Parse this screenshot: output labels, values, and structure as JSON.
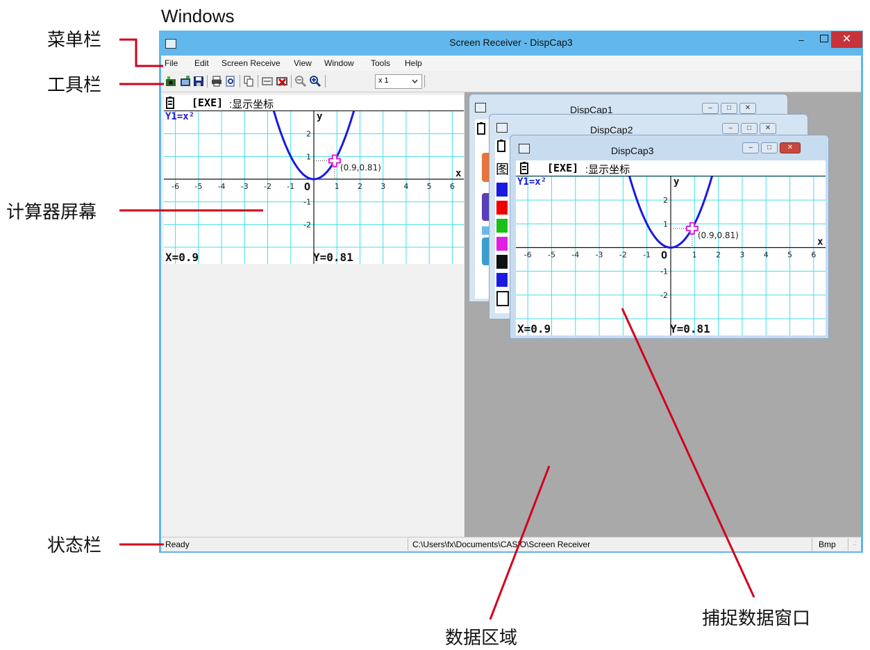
{
  "header_label": "Windows",
  "callouts": {
    "menubar": "菜单栏",
    "toolbar": "工具栏",
    "screen": "计算器屏幕",
    "statusbar": "状态栏",
    "data_area": "数据区域",
    "capture_window": "捕捉数据窗口"
  },
  "window": {
    "title": "Screen Receiver - DispCap3",
    "min_glyph": "–",
    "close_glyph": "✕"
  },
  "menu": [
    "File",
    "Edit",
    "Screen Receive",
    "View",
    "Window",
    "Tools",
    "Help"
  ],
  "toolbar": {
    "icons": [
      "capture-icon",
      "open-icon",
      "save-icon",
      "print-icon",
      "print-preview-icon",
      "copy-icon",
      "receive-icon",
      "stop-receive-icon",
      "zoom-out-icon",
      "zoom-in-icon"
    ],
    "zoom_value": "x 1"
  },
  "calc": {
    "head_key": "[EXE]",
    "head_text": ":显示坐标",
    "func_label": "Y1=x²",
    "axis_x": "x",
    "axis_y": "y",
    "origin": "O",
    "point_label": "(0.9,0.81)",
    "x_readout": "X=0.9",
    "y_readout": "Y=0.81",
    "point": {
      "x": 0.9,
      "y": 0.81
    },
    "xlim": [
      -6.5,
      6.5
    ],
    "ylim": [
      -3,
      3
    ],
    "x_ticks": [
      "-6",
      "-5",
      "-4",
      "-3",
      "-2",
      "-1",
      "1",
      "2",
      "3",
      "4",
      "5",
      "6"
    ],
    "y_ticks": [
      "2",
      "1",
      "-1",
      "-2"
    ],
    "curve_color": "#1a1ae0",
    "grid_color": "#40e0e8",
    "cursor_color": "#e020e0"
  },
  "children": {
    "c1": "DispCap1",
    "c2": "DispCap2",
    "c3": "DispCap3",
    "c2_partial_char": "图"
  },
  "statusbar": {
    "status": "Ready",
    "path": "C:\\Users\\fx\\Documents\\CASIO\\Screen Receiver",
    "format": "Bmp"
  },
  "colors": {
    "callout_line": "#d2001a",
    "titlebar": "#62b8ec",
    "close": "#c7333a"
  }
}
